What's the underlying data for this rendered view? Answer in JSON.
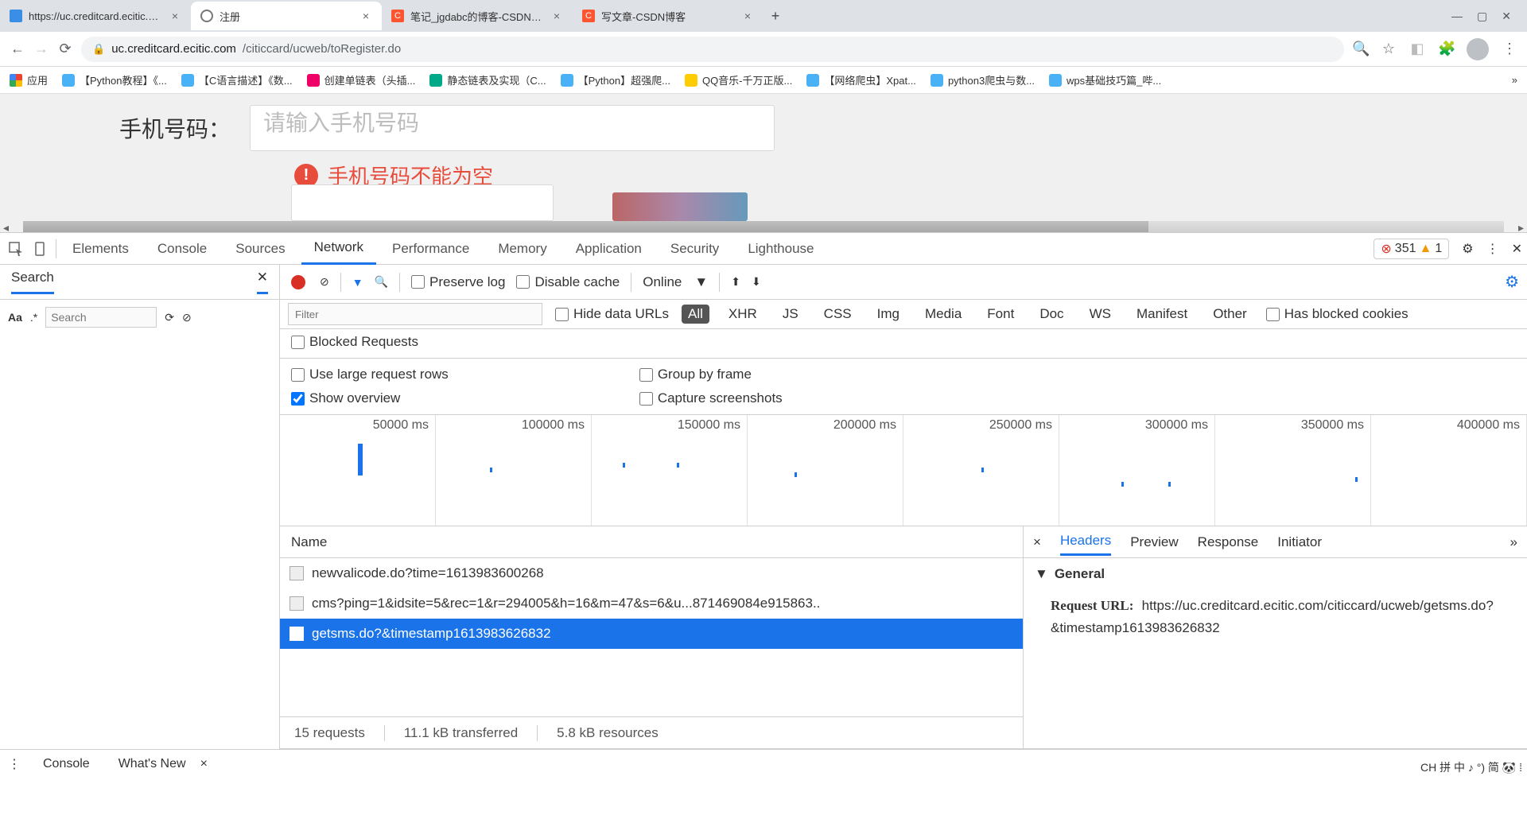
{
  "tabs": [
    {
      "title": "https://uc.creditcard.ecitic.com"
    },
    {
      "title": "注册"
    },
    {
      "title": "笔记_jgdabc的博客-CSDN博客"
    },
    {
      "title": "写文章-CSDN博客"
    }
  ],
  "url": {
    "host": "uc.creditcard.ecitic.com",
    "path": "/citiccard/ucweb/toRegister.do"
  },
  "bookmarks": {
    "apps": "应用",
    "items": [
      "【Python教程】《...",
      "【C语言描述】《数...",
      "创建单链表（头插...",
      "静态链表及实现（C...",
      "【Python】超强爬...",
      "QQ音乐-千万正版...",
      "【网络爬虫】Xpat...",
      "python3爬虫与数...",
      "wps基础技巧篇_哔..."
    ]
  },
  "page": {
    "phone_label": "手机号码：",
    "phone_placeholder": "请输入手机号码",
    "error_text": "手机号码不能为空"
  },
  "devtools": {
    "tabs": [
      "Elements",
      "Console",
      "Sources",
      "Network",
      "Performance",
      "Memory",
      "Application",
      "Security",
      "Lighthouse"
    ],
    "errors": "351",
    "warnings": "1",
    "search_label": "Search",
    "search_placeholder": "Search",
    "match_icon": ".*",
    "Aa": "Aa",
    "toolbar": {
      "preserve": "Preserve log",
      "disable_cache": "Disable cache",
      "online": "Online"
    },
    "filter": {
      "placeholder": "Filter",
      "hide_urls": "Hide data URLs",
      "types": [
        "All",
        "XHR",
        "JS",
        "CSS",
        "Img",
        "Media",
        "Font",
        "Doc",
        "WS",
        "Manifest",
        "Other"
      ],
      "blocked_cookies": "Has blocked cookies",
      "blocked_req": "Blocked Requests"
    },
    "options": {
      "large_rows": "Use large request rows",
      "show_overview": "Show overview",
      "group_frame": "Group by frame",
      "capture_ss": "Capture screenshots"
    },
    "timeline": [
      "50000 ms",
      "100000 ms",
      "150000 ms",
      "200000 ms",
      "250000 ms",
      "300000 ms",
      "350000 ms",
      "400000 ms"
    ],
    "requests": {
      "head": "Name",
      "rows": [
        "newvalicode.do?time=1613983600268",
        "cms?ping=1&idsite=5&rec=1&r=294005&h=16&m=47&s=6&u...871469084e915863..",
        "getsms.do?&timestamp1613983626832"
      ],
      "summary": {
        "count": "15 requests",
        "transferred": "11.1 kB transferred",
        "resources": "5.8 kB resources"
      }
    },
    "detail": {
      "tabs": [
        "Headers",
        "Preview",
        "Response",
        "Initiator"
      ],
      "general": "General",
      "kv_label": "Request URL:",
      "kv_value": "https://uc.creditcard.ecitic.com/citiccard/ucweb/getsms.do?&timestamp1613983626832"
    },
    "drawer": {
      "console": "Console",
      "whatsnew": "What's New"
    }
  },
  "ime": "CH 拼 中 ♪ °) 简 🐼 ⁞"
}
